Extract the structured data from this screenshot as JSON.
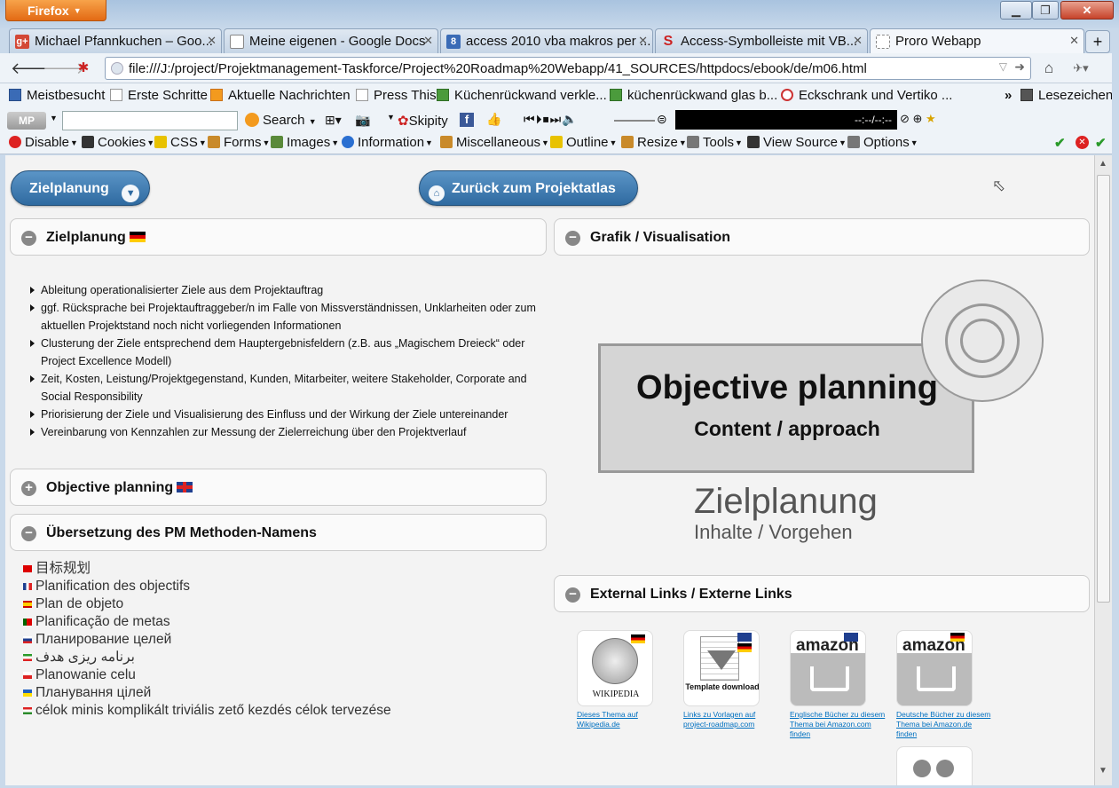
{
  "browser": {
    "menu_button": "Firefox",
    "tabs": [
      {
        "label": "Michael Pfannkuchen – Goo...",
        "icon": "google-plus-icon",
        "icon_text": "g+",
        "icon_color": "#d34836"
      },
      {
        "label": "Meine eigenen - Google Docs",
        "icon": "google-docs-icon",
        "icon_text": "",
        "icon_color": "#ffffff"
      },
      {
        "label": "access 2010 vba makros per ...",
        "icon": "google-search-icon",
        "icon_text": "8",
        "icon_color": "#3a6bb6"
      },
      {
        "label": "Access-Symbolleiste mit VB...",
        "icon": "s-logo-icon",
        "icon_text": "S",
        "icon_color": "#cc2222"
      },
      {
        "label": "Proro Webapp",
        "icon": "blank-page-icon",
        "icon_text": "",
        "icon_color": "#ffffff"
      }
    ],
    "url": "file:///J:/project/Projektmanagement-Taskforce/Project%20Roadmap%20Webapp/41_SOURCES/httpdocs/ebook/de/m06.html",
    "bookmarks": [
      {
        "label": "Meistbesucht",
        "icon": "bookmark-icon"
      },
      {
        "label": "Erste Schritte",
        "icon": "page-icon"
      },
      {
        "label": "Aktuelle Nachrichten",
        "icon": "rss-icon"
      },
      {
        "label": "Press This",
        "icon": "page-icon"
      },
      {
        "label": "Küchenrückwand verkle...",
        "icon": "green-site-icon"
      },
      {
        "label": "küchenrückwand glas b...",
        "icon": "green-site-icon"
      },
      {
        "label": "Eckschrank und Vertiko ...",
        "icon": "k-site-icon"
      }
    ],
    "bookmarks_overflow": "»",
    "bookmarks_menu": "Lesezeichen",
    "search_label": "Search",
    "skipity_label": "Skipity",
    "media_time": "--:--/--:--",
    "devbar": [
      {
        "label": "Disable",
        "icon": "disable-icon",
        "color": "#d22"
      },
      {
        "label": "Cookies",
        "icon": "cookies-icon",
        "color": "#333"
      },
      {
        "label": "CSS",
        "icon": "css-icon",
        "color": "#e8c200"
      },
      {
        "label": "Forms",
        "icon": "forms-icon",
        "color": "#c98a2a"
      },
      {
        "label": "Images",
        "icon": "images-icon",
        "color": "#5a8a3a"
      },
      {
        "label": "Information",
        "icon": "information-icon",
        "color": "#2a6fd1"
      },
      {
        "label": "Miscellaneous",
        "icon": "miscellaneous-icon",
        "color": "#c98a2a"
      },
      {
        "label": "Outline",
        "icon": "outline-icon",
        "color": "#e8c200"
      },
      {
        "label": "Resize",
        "icon": "resize-icon",
        "color": "#c98a2a"
      },
      {
        "label": "Tools",
        "icon": "tools-icon",
        "color": "#777"
      },
      {
        "label": "View Source",
        "icon": "view-source-icon",
        "color": "#333"
      },
      {
        "label": "Options",
        "icon": "options-icon",
        "color": "#777"
      }
    ]
  },
  "page": {
    "menu_button": "Zielplanung",
    "back_button": "Zurück zum Projektatlas",
    "panel_zielplanung": "Zielplanung",
    "bullets": [
      "Ableitung operationalisierter Ziele aus dem Projektauftrag",
      "ggf. Rücksprache bei Projektauftraggeber/n im Falle von Missverständnissen, Unklarheiten oder zum aktuellen Projektstand noch nicht vorliegenden Informationen",
      "Clusterung der Ziele entsprechend dem Hauptergebnisfeldern (z.B. aus „Magischem Dreieck“ oder Project Excellence Modell)",
      "Zeit, Kosten, Leistung/Projektgegenstand, Kunden, Mitarbeiter, weitere Stakeholder, Corporate and Social Responsibility",
      "Priorisierung der Ziele und Visualisierung des Einfluss und der Wirkung der Ziele untereinander",
      "Vereinbarung von Kennzahlen zur Messung der Zielerreichung über den Projektverlauf"
    ],
    "panel_objective": "Objective planning",
    "panel_translation": "Übersetzung des PM Methoden-Namens",
    "translations": [
      {
        "text": "目标规划",
        "flag": "china-flag-icon"
      },
      {
        "text": "Planification des objectifs",
        "flag": "france-flag-icon"
      },
      {
        "text": "Plan de objeto",
        "flag": "spain-flag-icon"
      },
      {
        "text": "Planificação de metas",
        "flag": "portugal-flag-icon"
      },
      {
        "text": "Планирование целей",
        "flag": "russia-flag-icon"
      },
      {
        "text": "برنامه ریزی هدف",
        "flag": "iran-flag-icon"
      },
      {
        "text": "Planowanie celu",
        "flag": "poland-flag-icon"
      },
      {
        "text": "Планування цілей",
        "flag": "ukraine-flag-icon"
      },
      {
        "text": "célok minis komplikált triviális zető kezdés célok tervezése",
        "flag": "hungary-flag-icon"
      }
    ],
    "panel_grafik": "Grafik / Visualisation",
    "graphic": {
      "title": "Objective planning",
      "subtitle": "Content / approach",
      "de_title": "Zielplanung",
      "de_subtitle": "Inhalte / Vorgehen"
    },
    "panel_links": "External Links / Externe Links",
    "links": [
      {
        "logo": "WIKIPEDIA",
        "caption": "Dieses Thema auf Wikipedia.de"
      },
      {
        "logo": "Template download",
        "caption": "Links zu Vorlagen auf project-roadmap.com"
      },
      {
        "logo": "amazon",
        "caption": "Englische Bücher zu diesem Thema bei Amazon.com finden"
      },
      {
        "logo": "amazon",
        "caption": "Deutsche Bücher zu diesem Thema bei Amazon.de finden"
      }
    ]
  }
}
